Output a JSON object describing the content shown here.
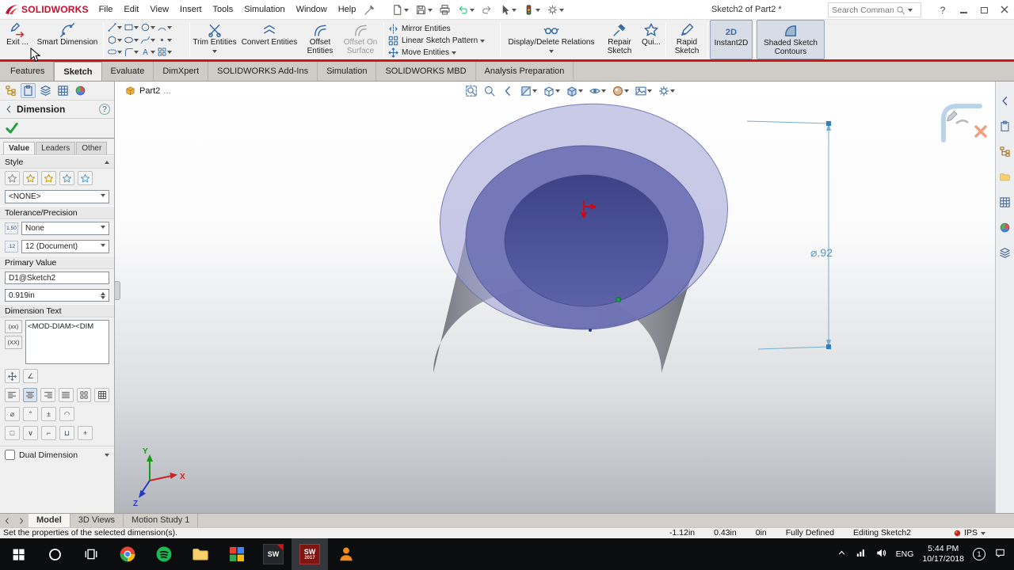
{
  "titlebar": {
    "brand": "SOLIDWORKS",
    "menus": [
      "File",
      "Edit",
      "View",
      "Insert",
      "Tools",
      "Simulation",
      "Window",
      "Help"
    ],
    "document_title": "Sketch2 of Part2 *",
    "search_placeholder": "Search Commands",
    "help_label": "?"
  },
  "ribbon": {
    "exit_sketch_label": "Exit ...",
    "smart_dimension_label": "Smart Dimension",
    "trim_label": "Trim Entities",
    "convert_label": "Convert Entities",
    "offset_label": "Offset Entities",
    "offset_surface_label": "Offset On Surface",
    "mirror_label": "Mirror Entities",
    "linear_pattern_label": "Linear Sketch Pattern",
    "move_label": "Move Entities",
    "display_delete_label": "Display/Delete Relations",
    "repair_label": "Repair Sketch",
    "quick_snaps_label": "Qui...",
    "rapid_label": "Rapid Sketch",
    "instant2d_label": "Instant2D",
    "shaded_contours_label": "Shaded Sketch Contours"
  },
  "command_tabs": [
    "Features",
    "Sketch",
    "Evaluate",
    "DimXpert",
    "SOLIDWORKS Add-Ins",
    "Simulation",
    "SOLIDWORKS MBD",
    "Analysis Preparation"
  ],
  "panel": {
    "title": "Dimension",
    "help_label": "?",
    "tabs": [
      "Value",
      "Leaders",
      "Other"
    ],
    "style_header": "Style",
    "style_value": "<NONE>",
    "tolerance_header": "Tolerance/Precision",
    "tolerance_icon_label": "1.50",
    "precision_icon_label": ".12",
    "tolerance_value": "None",
    "precision_value": "12 (Document)",
    "primary_header": "Primary Value",
    "primary_name": "D1@Sketch2",
    "primary_value": "0.919in",
    "dimension_text_header": "Dimension Text",
    "dimension_text_value": "<MOD-DIAM><DIM",
    "text_token_1": "(xx)",
    "text_token_2": "(XX)",
    "angle_glyph": "∠",
    "symbols_row1": [
      "⌀",
      "°",
      "±",
      "◠"
    ],
    "symbols_row2": [
      "□",
      "∨",
      "⌐",
      "⊔",
      "+"
    ],
    "dual_label": "Dual Dimension"
  },
  "viewport": {
    "tree_root": "Part2",
    "tree_ellipsis": "...",
    "dimension_label": "⌀.92",
    "triad": {
      "x": "X",
      "y": "Y",
      "z": "Z"
    }
  },
  "bottom_tabs": [
    "Model",
    "3D Views",
    "Motion Study 1"
  ],
  "statusbar": {
    "message": "Set the properties of the selected dimension(s).",
    "coord_x": "-1.12in",
    "coord_y": "0.43in",
    "coord_z": "0in",
    "state": "Fully Defined",
    "editing": "Editing Sketch2",
    "units": "IPS"
  },
  "taskbar": {
    "language": "ENG",
    "time": "5:44 PM",
    "date": "10/17/2018",
    "badge": "1"
  },
  "colors": {
    "brand_red": "#c8102e",
    "ribbon_accent_red": "#d2150f",
    "dimension_blue": "#4e9ac6",
    "sketch_face_purple": "#6a6fb3",
    "taskbar_black": "#0c0d0f"
  }
}
